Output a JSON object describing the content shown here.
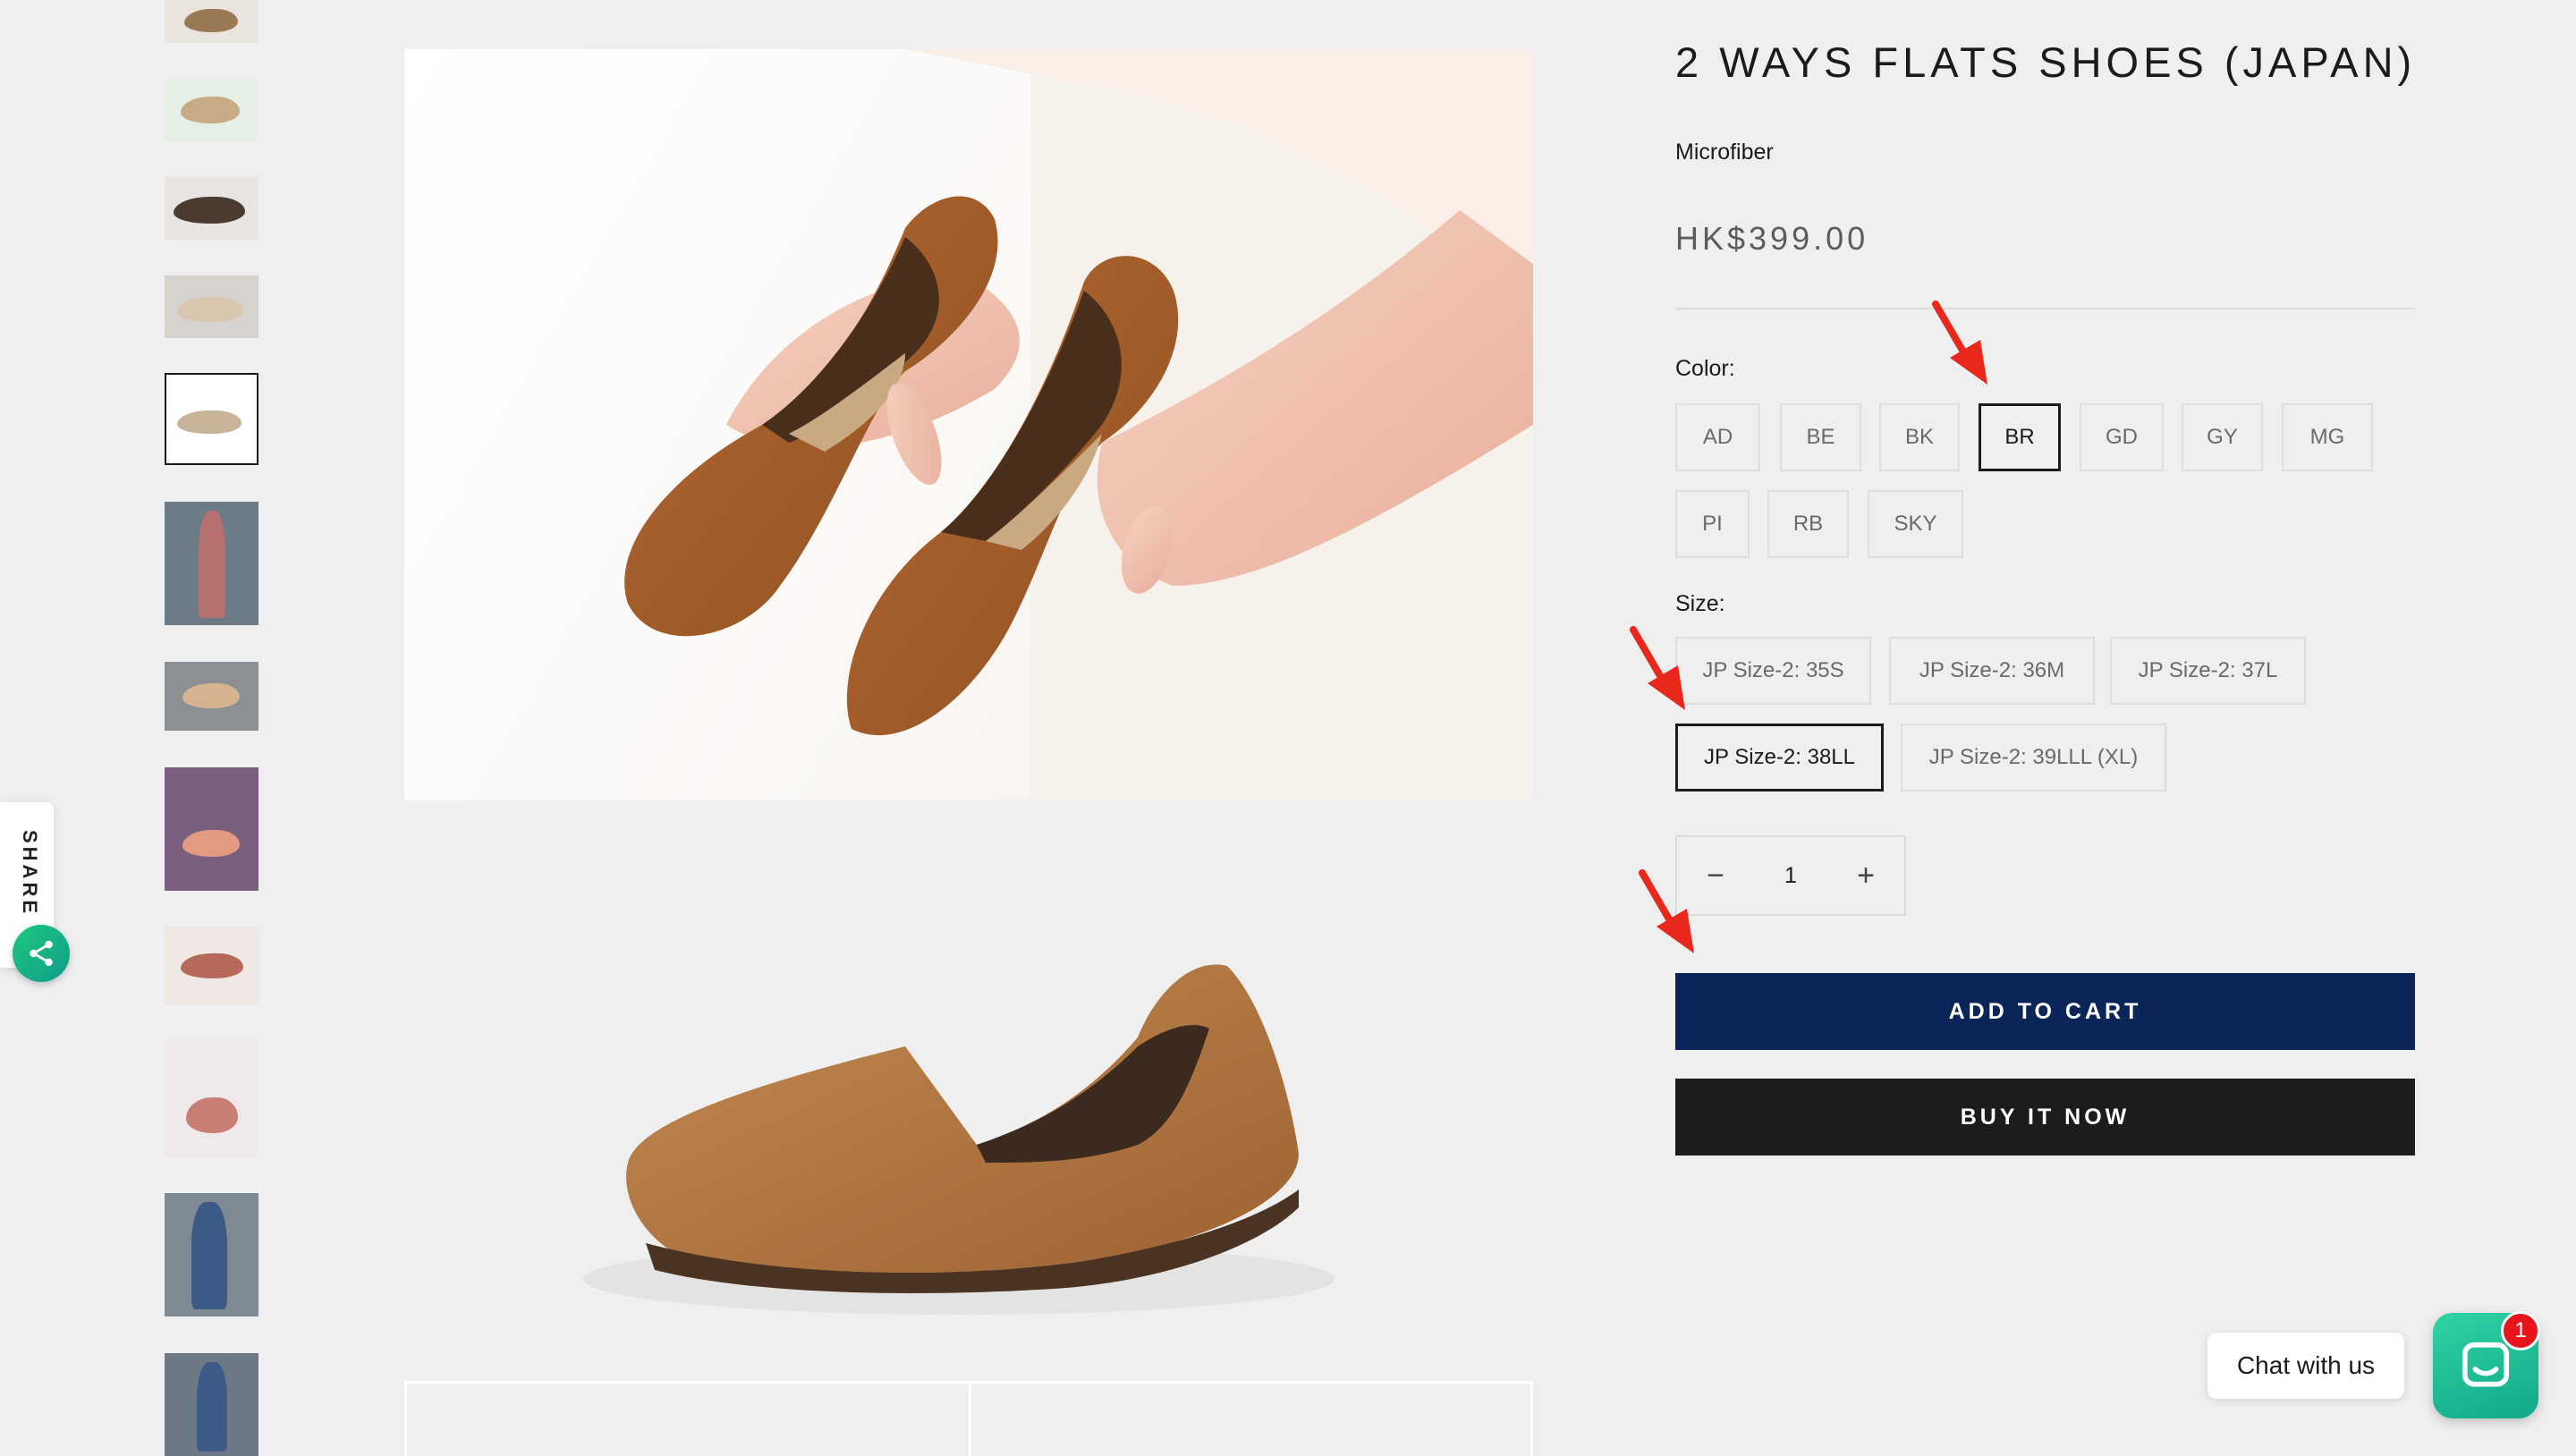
{
  "product": {
    "title": "2 WAYS FLATS SHOES (JAPAN)",
    "material": "Microfiber",
    "price": "HK$399.00"
  },
  "share": {
    "label": "SHARE",
    "icon": "share-icon"
  },
  "color_option": {
    "label": "Color:",
    "values": [
      "AD",
      "BE",
      "BK",
      "BR",
      "GD",
      "GY",
      "MG",
      "PI",
      "RB",
      "SKY"
    ],
    "selected": "BR"
  },
  "size_option": {
    "label": "Size:",
    "values": [
      "JP Size-2: 35S",
      "JP Size-2: 36M",
      "JP Size-2: 37L",
      "JP Size-2: 38LL",
      "JP Size-2: 39LLL (XL)"
    ],
    "selected": "JP Size-2: 38LL"
  },
  "quantity": {
    "value": "1",
    "minus": "−",
    "plus": "+"
  },
  "buttons": {
    "add_to_cart": "ADD TO CART",
    "buy_now": "BUY IT NOW"
  },
  "chat": {
    "label": "Chat with us",
    "badge": "1",
    "icon": "chat-icon"
  },
  "colors": {
    "primary_button": "#0b2559",
    "secondary_button": "#1c1c1c",
    "annotation_arrow": "#e8281a",
    "chat_accent": "#1fc39a",
    "badge": "#e8141c"
  }
}
